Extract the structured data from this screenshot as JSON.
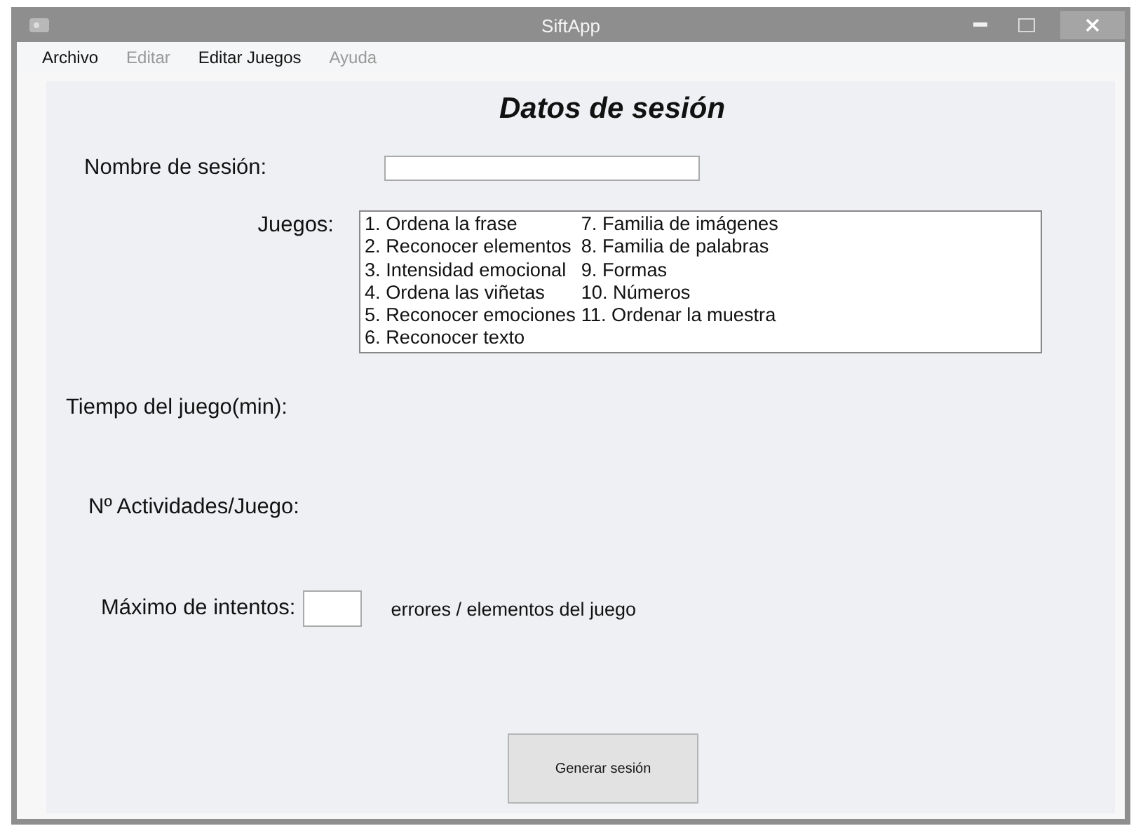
{
  "window": {
    "title": "SiftApp"
  },
  "menu": [
    {
      "label": "Archivo",
      "disabled": false
    },
    {
      "label": "Editar",
      "disabled": true
    },
    {
      "label": "Editar Juegos",
      "disabled": false
    },
    {
      "label": "Ayuda",
      "disabled": true
    }
  ],
  "form": {
    "heading": "Datos de sesión",
    "session_name": {
      "label": "Nombre de sesión:"
    },
    "games": {
      "label": "Juegos:",
      "items": [
        "1. Ordena la frase",
        "2. Reconocer elementos",
        "3. Intensidad emocional",
        "4. Ordena las viñetas",
        "5. Reconocer emociones",
        "6. Reconocer texto",
        "7. Familia de imágenes",
        "8. Familia de palabras",
        "9. Formas",
        "10. Números",
        "11. Ordenar la muestra"
      ]
    },
    "game_time": {
      "label": "Tiempo del juego(min):"
    },
    "activities": {
      "label": "Nº Actividades/Juego:"
    },
    "max_attempts": {
      "label": "Máximo de intentos:",
      "suffix": "errores / elementos del juego"
    },
    "submit": "Generar sesión"
  }
}
